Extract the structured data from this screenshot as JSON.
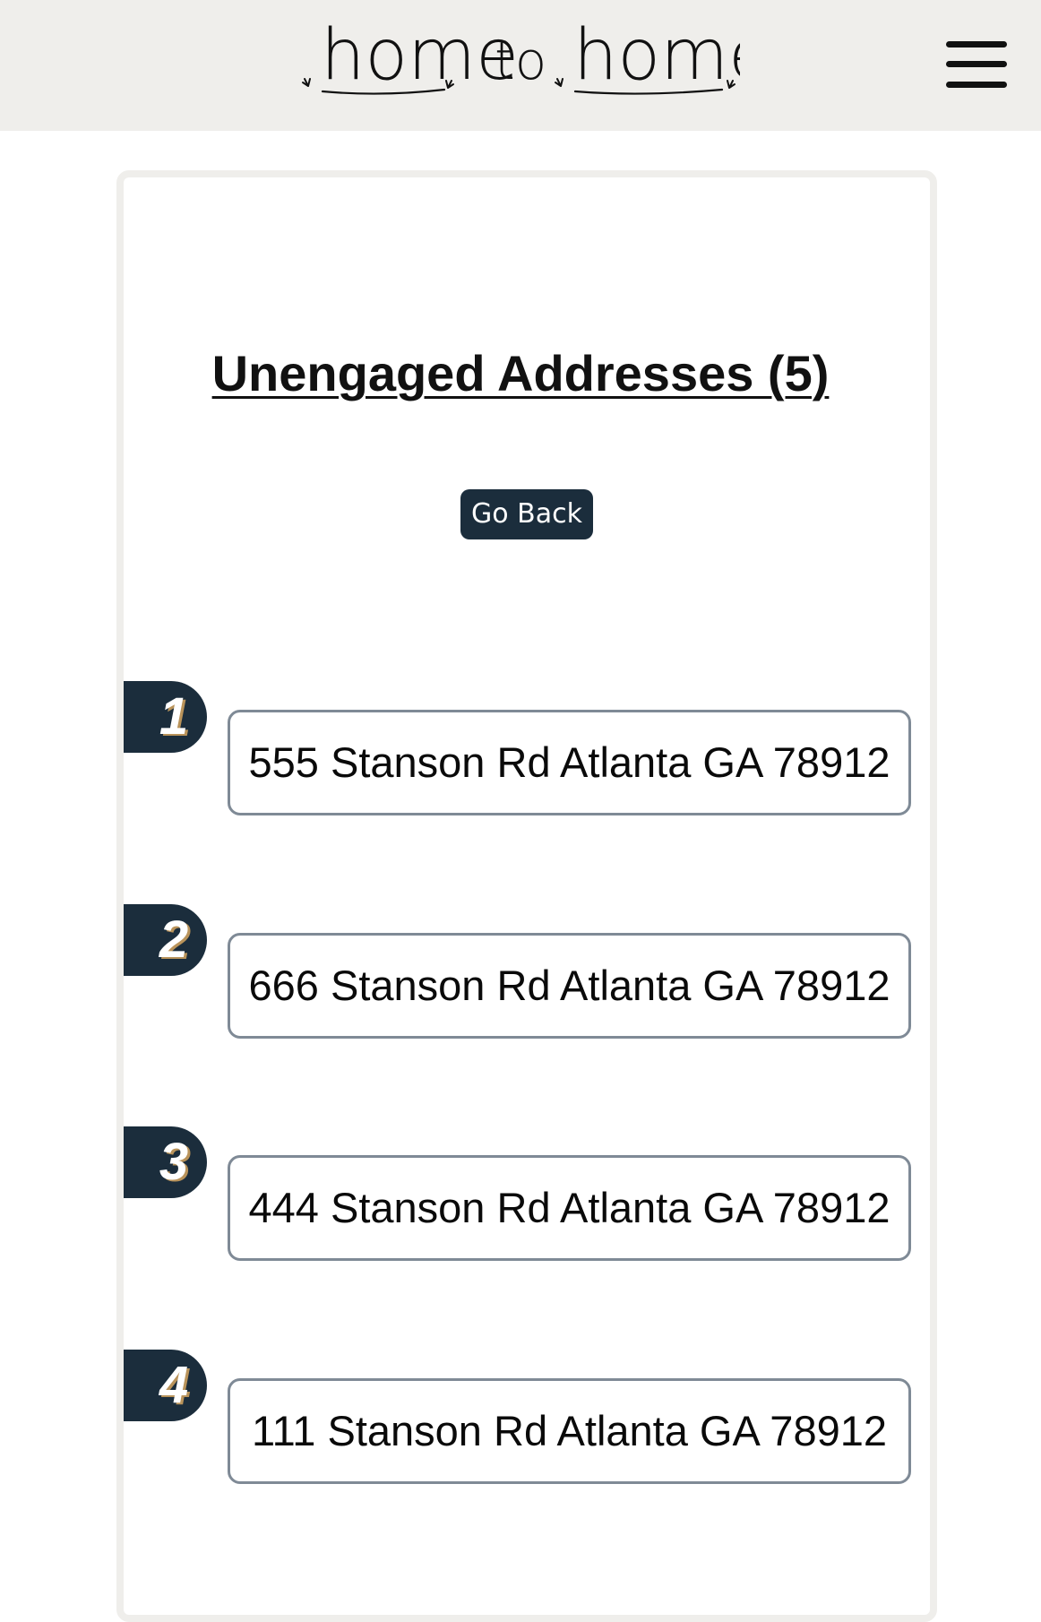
{
  "header": {
    "logo": {
      "word_left": "home",
      "word_middle": "to",
      "word_right": "home"
    }
  },
  "main": {
    "title": "Unengaged Addresses (5)",
    "go_back_label": "Go Back",
    "addresses": [
      {
        "number": "1",
        "address": "555 Stanson Rd Atlanta GA 78912"
      },
      {
        "number": "2",
        "address": "666 Stanson Rd Atlanta GA 78912"
      },
      {
        "number": "3",
        "address": "444 Stanson Rd Atlanta GA 78912"
      },
      {
        "number": "4",
        "address": "111 Stanson Rd Atlanta GA 78912"
      }
    ]
  },
  "colors": {
    "header_bg": "#efeeeb",
    "accent_dark": "#1b2d3c",
    "badge_shadow": "#b9935a",
    "box_border": "#7f8a96"
  },
  "icons": {
    "menu": "hamburger-menu-icon",
    "logo_sprouts": "sprout-icon"
  }
}
